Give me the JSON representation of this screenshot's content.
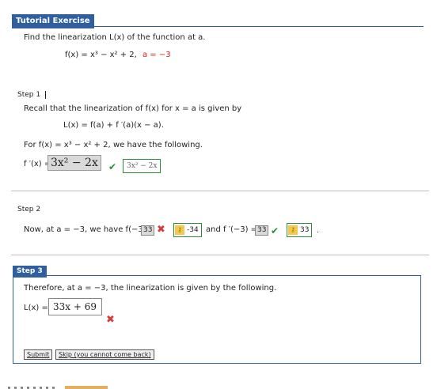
{
  "header": {
    "title": "Tutorial Exercise"
  },
  "problem": {
    "instruction": "Find the linearization L(x) of the function at a.",
    "function": "f(x) = x³ − x² + 2,",
    "a_value": "a = −3"
  },
  "step1": {
    "label": "Step 1",
    "recall": "Recall that the linearization of f(x) for x = a is given by",
    "formula": "L(x) = f(a) + f ′(a)(x − a).",
    "for_prefix": "For f(x) = x³ − x² + 2,",
    "for_suffix": "we have the following.",
    "deriv_label": "f ′(x) =",
    "deriv_input": "3x² − 2x",
    "deriv_answer": "3x² − 2x"
  },
  "step2": {
    "label": "Step 2",
    "now_prefix": "Now, at a = −3, we have f(−3) =",
    "f_value": "33",
    "f_correct": "-34",
    "and_text": "and f ′(−3) =",
    "fp_value": "33",
    "fp_correct": "33",
    "period": "."
  },
  "step3": {
    "label": "Step 3",
    "therefore": "Therefore, at a = −3, the linearization is given by the following.",
    "L_label": "L(x) =",
    "L_input": "33x + 69",
    "submit_label": "Submit",
    "skip_label": "Skip (you cannot come back)"
  },
  "colors": {
    "accent": "#2f5f9e",
    "correct": "#2e8b3c",
    "incorrect": "#d93a3a"
  }
}
